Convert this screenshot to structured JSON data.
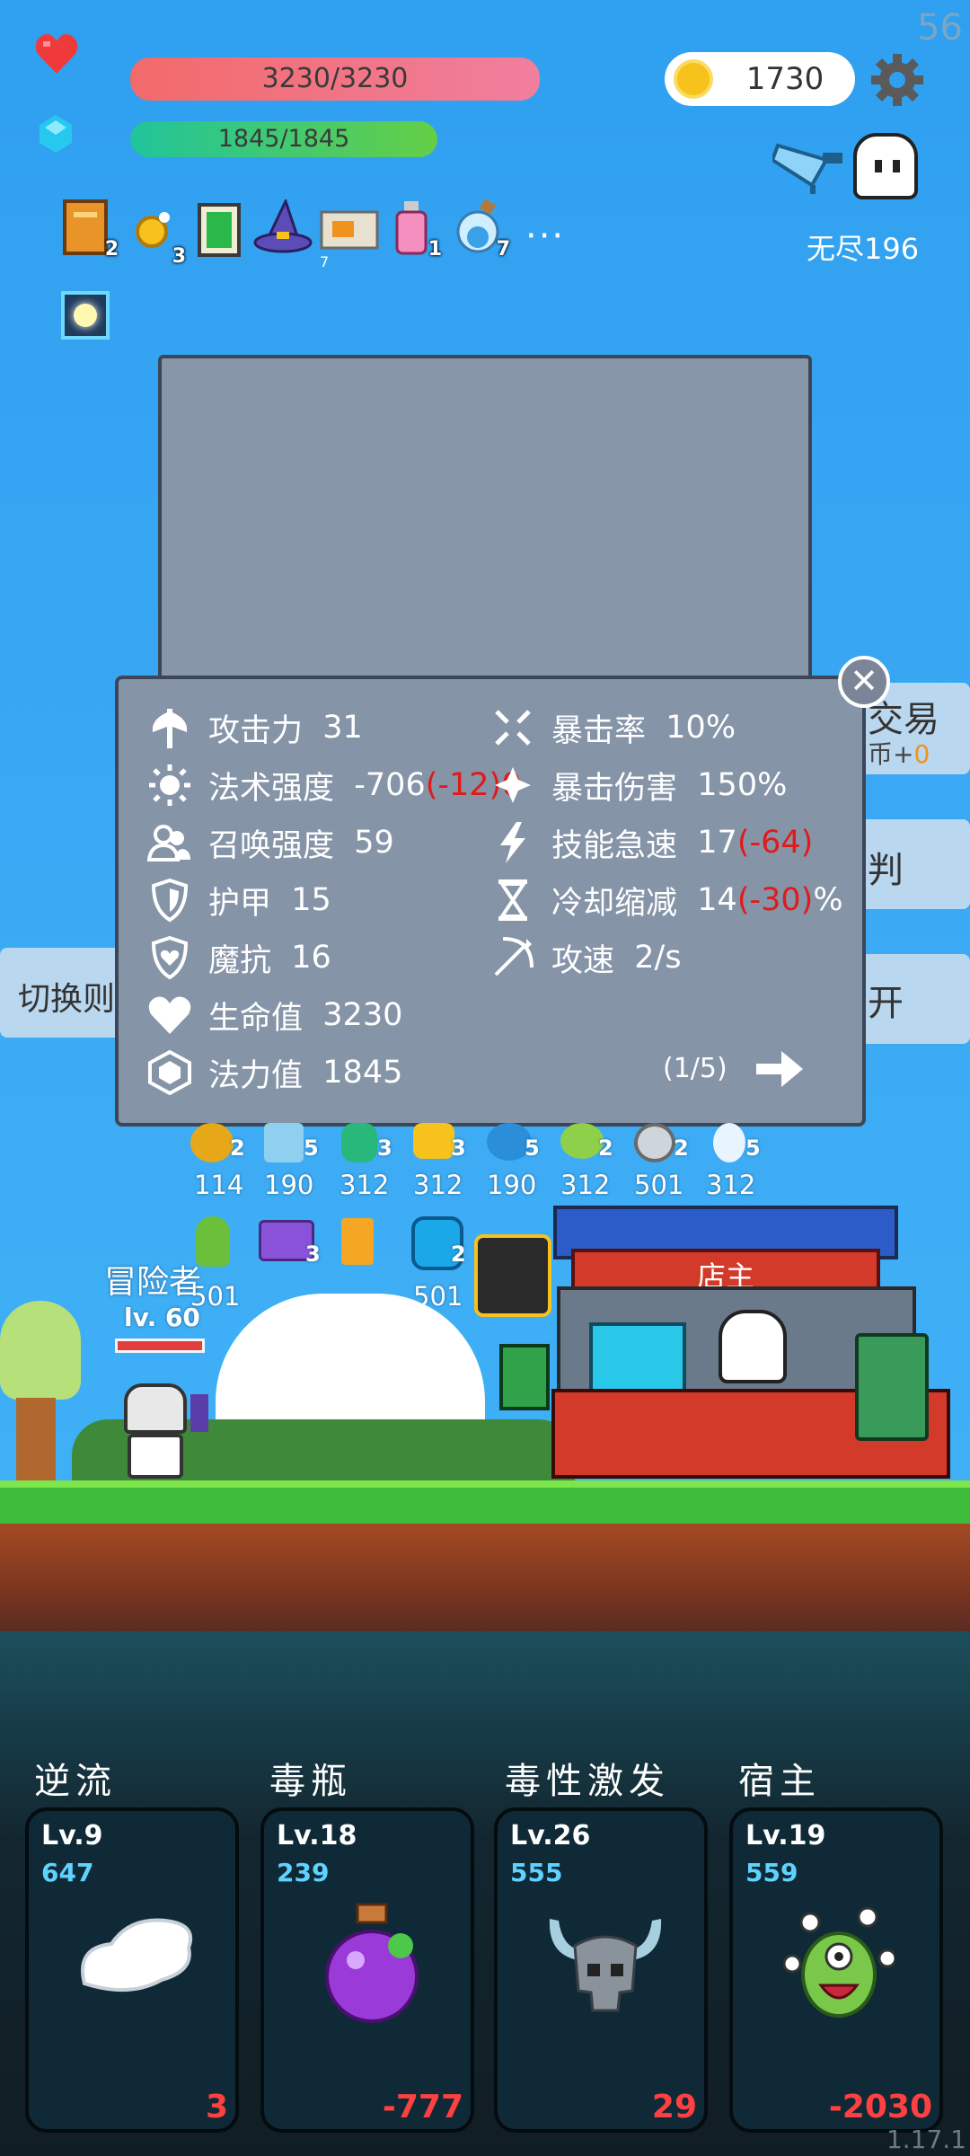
{
  "fps": "56",
  "hud": {
    "hp": "3230/3230",
    "mp": "1845/1845",
    "gold": "1730",
    "endless_label": "无尽196"
  },
  "inventory": [
    {
      "icon": "book-icon",
      "count": "2"
    },
    {
      "icon": "sun-ring-icon",
      "count": "3"
    },
    {
      "icon": "green-card-icon",
      "count": ""
    },
    {
      "icon": "wizard-hat-icon",
      "count": ""
    },
    {
      "icon": "briefcase-icon",
      "count": "7"
    },
    {
      "icon": "pink-potion-icon",
      "count": "1"
    },
    {
      "icon": "blue-orb-potion-icon",
      "count": "7"
    }
  ],
  "more": "···",
  "stats": {
    "left": [
      {
        "icon": "axe-icon",
        "label": "攻击力",
        "value": "31",
        "delta": ""
      },
      {
        "icon": "sun-icon",
        "label": "法术强度",
        "value": "-706",
        "delta": "(-12)"
      },
      {
        "icon": "summon-icon",
        "label": "召唤强度",
        "value": "59",
        "delta": ""
      },
      {
        "icon": "shield-icon",
        "label": "护甲",
        "value": "15",
        "delta": ""
      },
      {
        "icon": "heart-shield-icon",
        "label": "魔抗",
        "value": "16",
        "delta": ""
      },
      {
        "icon": "heart-icon",
        "label": "生命值",
        "value": "3230",
        "delta": ""
      },
      {
        "icon": "mana-gem-icon",
        "label": "法力值",
        "value": "1845",
        "delta": ""
      }
    ],
    "right": [
      {
        "icon": "crit-star-icon",
        "label": "暴击率",
        "value": "10%",
        "delta": ""
      },
      {
        "icon": "crit-damage-icon",
        "label": "暴击伤害",
        "value": "150%",
        "delta": ""
      },
      {
        "icon": "lightning-icon",
        "label": "技能急速",
        "value": "17",
        "delta": "(-64)"
      },
      {
        "icon": "hourglass-icon",
        "label": "冷却缩减",
        "value": "14",
        "delta": "(-30)",
        "suffix": "%"
      },
      {
        "icon": "bow-icon",
        "label": "攻速",
        "value": "2/s",
        "delta": ""
      }
    ],
    "page": "(1/5)",
    "overlap_text": "0"
  },
  "side": {
    "trade": "交易",
    "trade_sub": "币+",
    "trade_sub_value": "0",
    "judge": "判",
    "open": "开",
    "switch": "切换则"
  },
  "shop": {
    "counts_row1": [
      "2",
      "5",
      "3",
      "3",
      "5",
      "2",
      "2",
      "5"
    ],
    "prices_row1": [
      "114",
      "190",
      "312",
      "312",
      "190",
      "312",
      "501",
      "312"
    ],
    "counts_row2": [
      "",
      "3",
      "",
      "2"
    ],
    "prices_row2": [
      "501",
      "",
      "",
      "501"
    ],
    "owner_label": "店主"
  },
  "player": {
    "name": "冒险者",
    "level": "lv. 60"
  },
  "skills": [
    {
      "name": "逆流",
      "lv": "Lv.9",
      "cost": "647",
      "value": "3",
      "icon": "wing-icon"
    },
    {
      "name": "毒瓶",
      "lv": "Lv.18",
      "cost": "239",
      "value": "-777",
      "icon": "poison-flask-icon"
    },
    {
      "name": "毒性激发",
      "lv": "Lv.26",
      "cost": "555",
      "value": "29",
      "icon": "horned-skull-icon"
    },
    {
      "name": "宿主",
      "lv": "Lv.19",
      "cost": "559",
      "value": "-2030",
      "icon": "eye-monster-icon"
    }
  ],
  "version": "1.17.1",
  "colors": {
    "hp": "#f26a6a",
    "mp": "#3fca7a",
    "panel": "#8694a8",
    "negative": "#e01a1a",
    "cost": "#5fd2ff"
  }
}
